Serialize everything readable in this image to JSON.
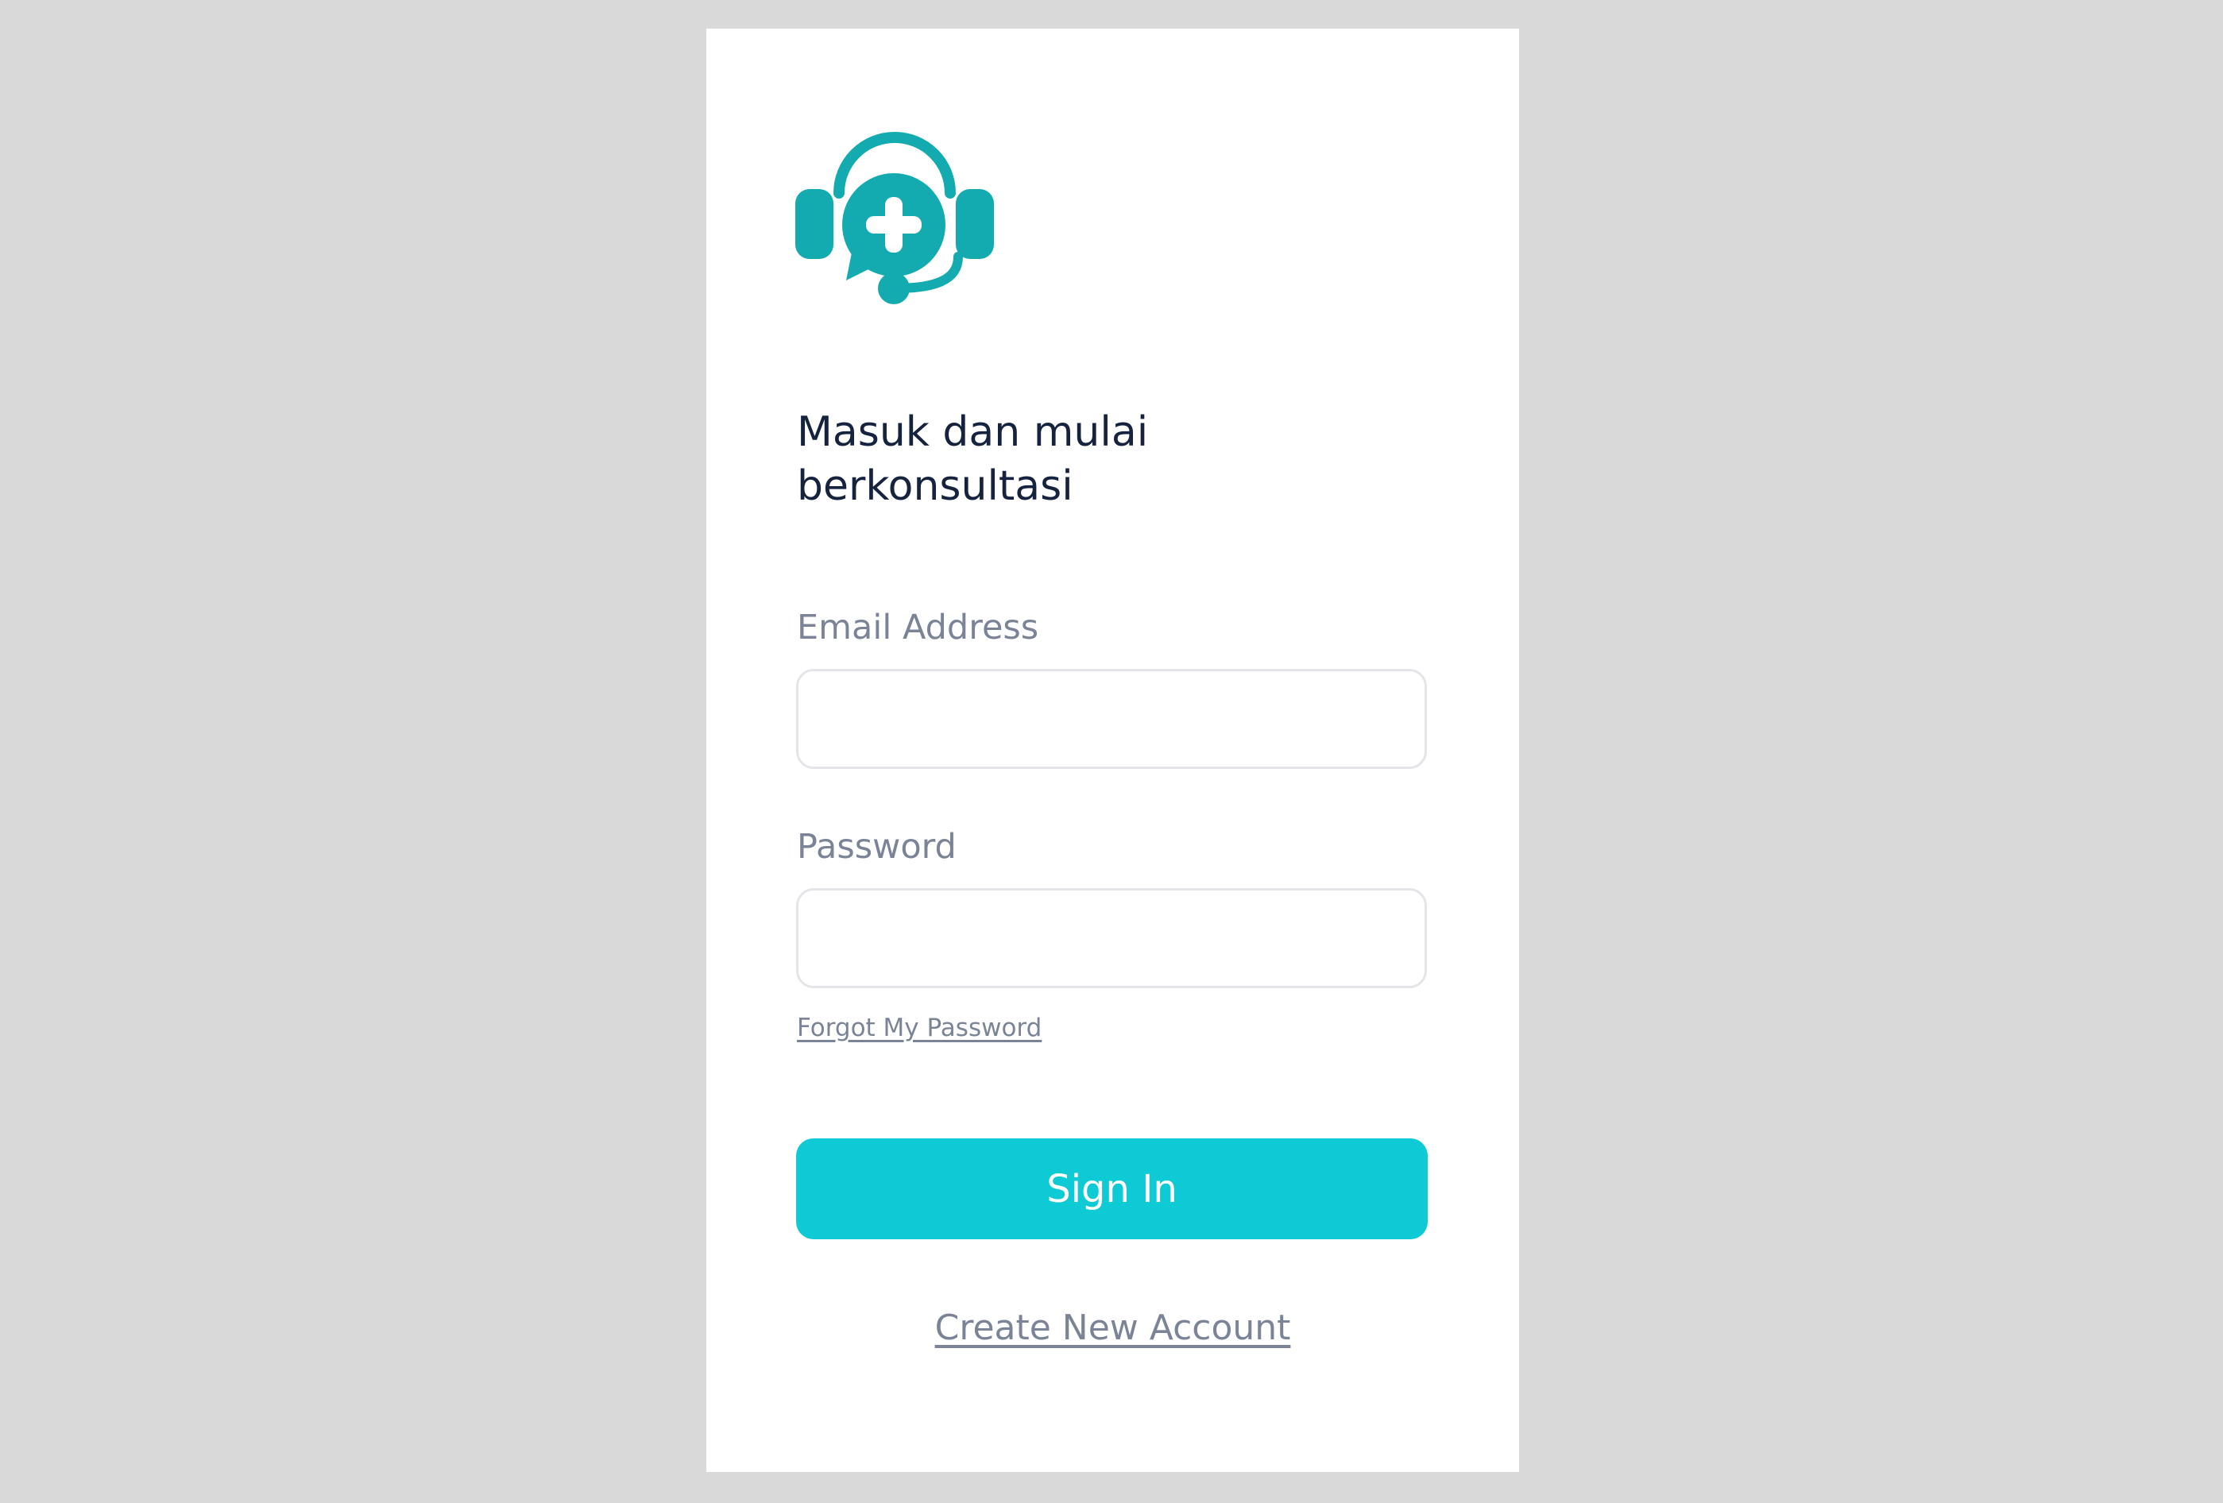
{
  "brand": {
    "logo_icon": "medical-consult-headset-icon",
    "logo_color": "#14abb0"
  },
  "headline": {
    "line1": "Masuk dan mulai",
    "line2": "berkonsultasi"
  },
  "form": {
    "email": {
      "label": "Email Address",
      "value": "",
      "placeholder": ""
    },
    "password": {
      "label": "Password",
      "value": "",
      "placeholder": ""
    },
    "forgot_password_label": "Forgot My Password",
    "submit_label": "Sign In",
    "create_account_label": "Create New Account"
  },
  "colors": {
    "accent": "#0dcad4",
    "heading": "#16233f",
    "muted": "#7b8496",
    "background": "#d9d9d9",
    "card": "#ffffff"
  }
}
